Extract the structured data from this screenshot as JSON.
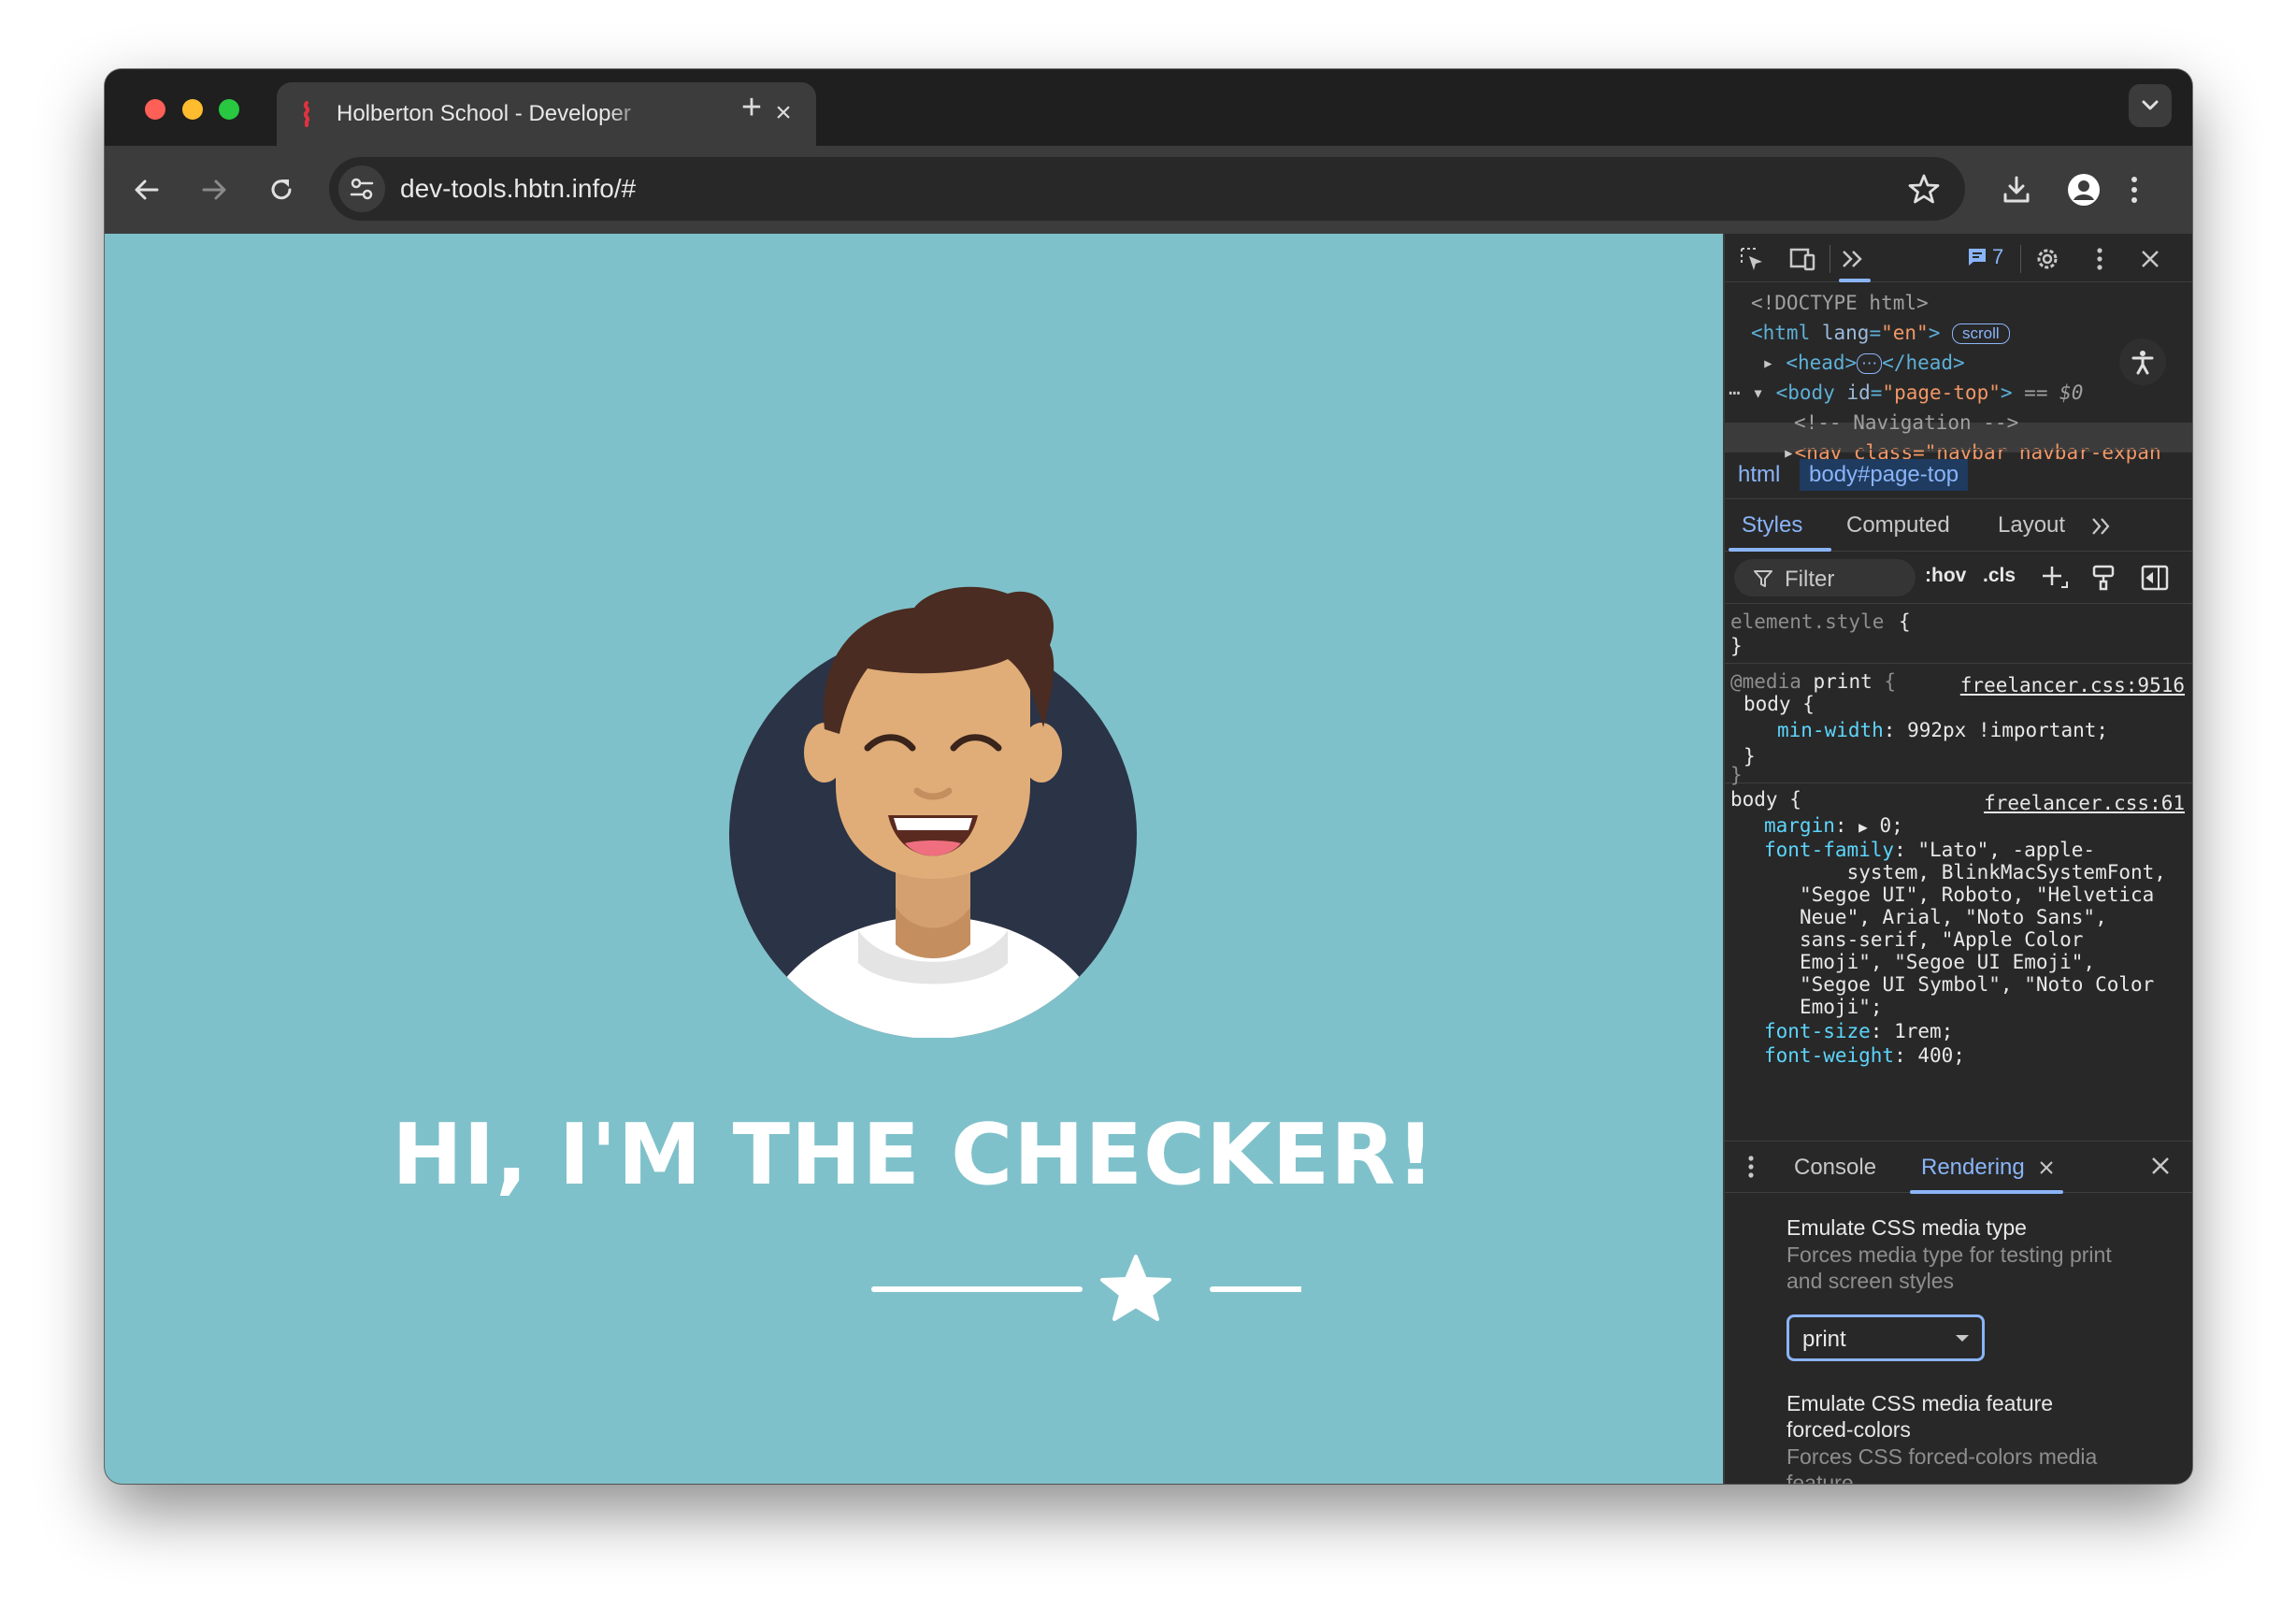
{
  "browser": {
    "tab_title": "Holberton School - Developer",
    "url": "dev-tools.hbtn.info/#"
  },
  "page": {
    "headline": "HI, I'M THE CHECKER!",
    "background_color": "#7fc1ca"
  },
  "devtools": {
    "issues_count": "7",
    "elements": {
      "doctype": "<!DOCTYPE html>",
      "html_open": "<html",
      "html_lang_attr": "lang",
      "html_lang_value": "\"en\"",
      "html_close_bracket": ">",
      "scroll_badge": "scroll",
      "head_open": "<head>",
      "head_ellipsis": "⋯",
      "head_close": "</head>",
      "body_open": "<body",
      "body_id_attr": "id",
      "body_id_value": "\"page-top\"",
      "body_close_bracket": ">",
      "body_marker": "== $0",
      "nav_comment": "<!-- Navigation -->",
      "nav_line": "<nav class=\"navbar navbar-expan"
    },
    "breadcrumbs": [
      "html",
      "body#page-top"
    ],
    "subtabs": [
      "Styles",
      "Computed",
      "Layout"
    ],
    "filter_placeholder": "Filter",
    "filter_buttons": [
      ":hov",
      ".cls"
    ],
    "styles": {
      "element_style": "element.style",
      "media_at": "@media",
      "media_type": "print",
      "media_source": "freelancer.css:9516",
      "media_selector": "body",
      "min_width_prop": "min-width",
      "min_width_value": "992px !important;",
      "body_selector": "body",
      "body_source": "freelancer.css:61",
      "margin_prop": "margin",
      "margin_value": "0;",
      "font_family_prop": "font-family",
      "font_family_lines": [
        "\"Lato\", -apple-",
        "    system, BlinkMacSystemFont,",
        "\"Segoe UI\", Roboto, \"Helvetica",
        "Neue\", Arial, \"Noto Sans\",",
        "sans-serif, \"Apple Color",
        "Emoji\", \"Segoe UI Emoji\",",
        "\"Segoe UI Symbol\", \"Noto Color",
        "Emoji\";"
      ],
      "font_size_prop": "font-size",
      "font_size_value": "1rem;",
      "font_weight_prop": "font-weight",
      "font_weight_value": "400;"
    },
    "drawer_tabs": [
      "Console",
      "Rendering"
    ],
    "rendering": {
      "media_type_title": "Emulate CSS media type",
      "media_type_desc": "Forces media type for testing print and screen styles",
      "media_type_value": "print",
      "forced_colors_title_1": "Emulate CSS media feature",
      "forced_colors_title_2": "forced-colors",
      "forced_colors_desc": "Forces CSS forced-colors media feature"
    }
  }
}
